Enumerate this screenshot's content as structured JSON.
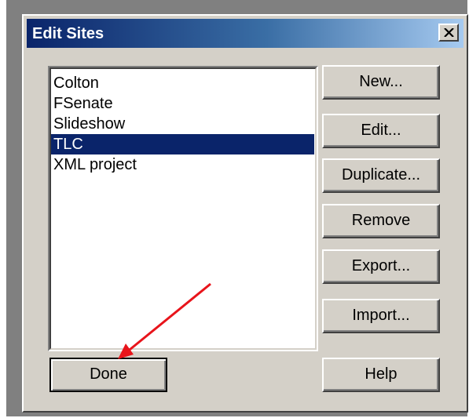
{
  "dialog": {
    "title": "Edit Sites",
    "close_glyph": "×"
  },
  "sites": {
    "items": [
      {
        "label": "Colton",
        "selected": false
      },
      {
        "label": "FSenate",
        "selected": false
      },
      {
        "label": "Slideshow",
        "selected": false
      },
      {
        "label": "TLC",
        "selected": true
      },
      {
        "label": "XML project",
        "selected": false
      }
    ]
  },
  "buttons": {
    "new_label": "New...",
    "edit_label": "Edit...",
    "duplicate_label": "Duplicate...",
    "remove_label": "Remove",
    "export_label": "Export...",
    "import_label": "Import...",
    "done_label": "Done",
    "help_label": "Help"
  },
  "colors": {
    "titlebar_start": "#0a246a",
    "titlebar_end": "#a6caf0",
    "selection": "#0a246a",
    "dialog_face": "#d4d0c8",
    "annotation_arrow": "#e8141b"
  },
  "icons": {
    "close": "close-icon",
    "annotation": "arrow-annotation-icon"
  }
}
